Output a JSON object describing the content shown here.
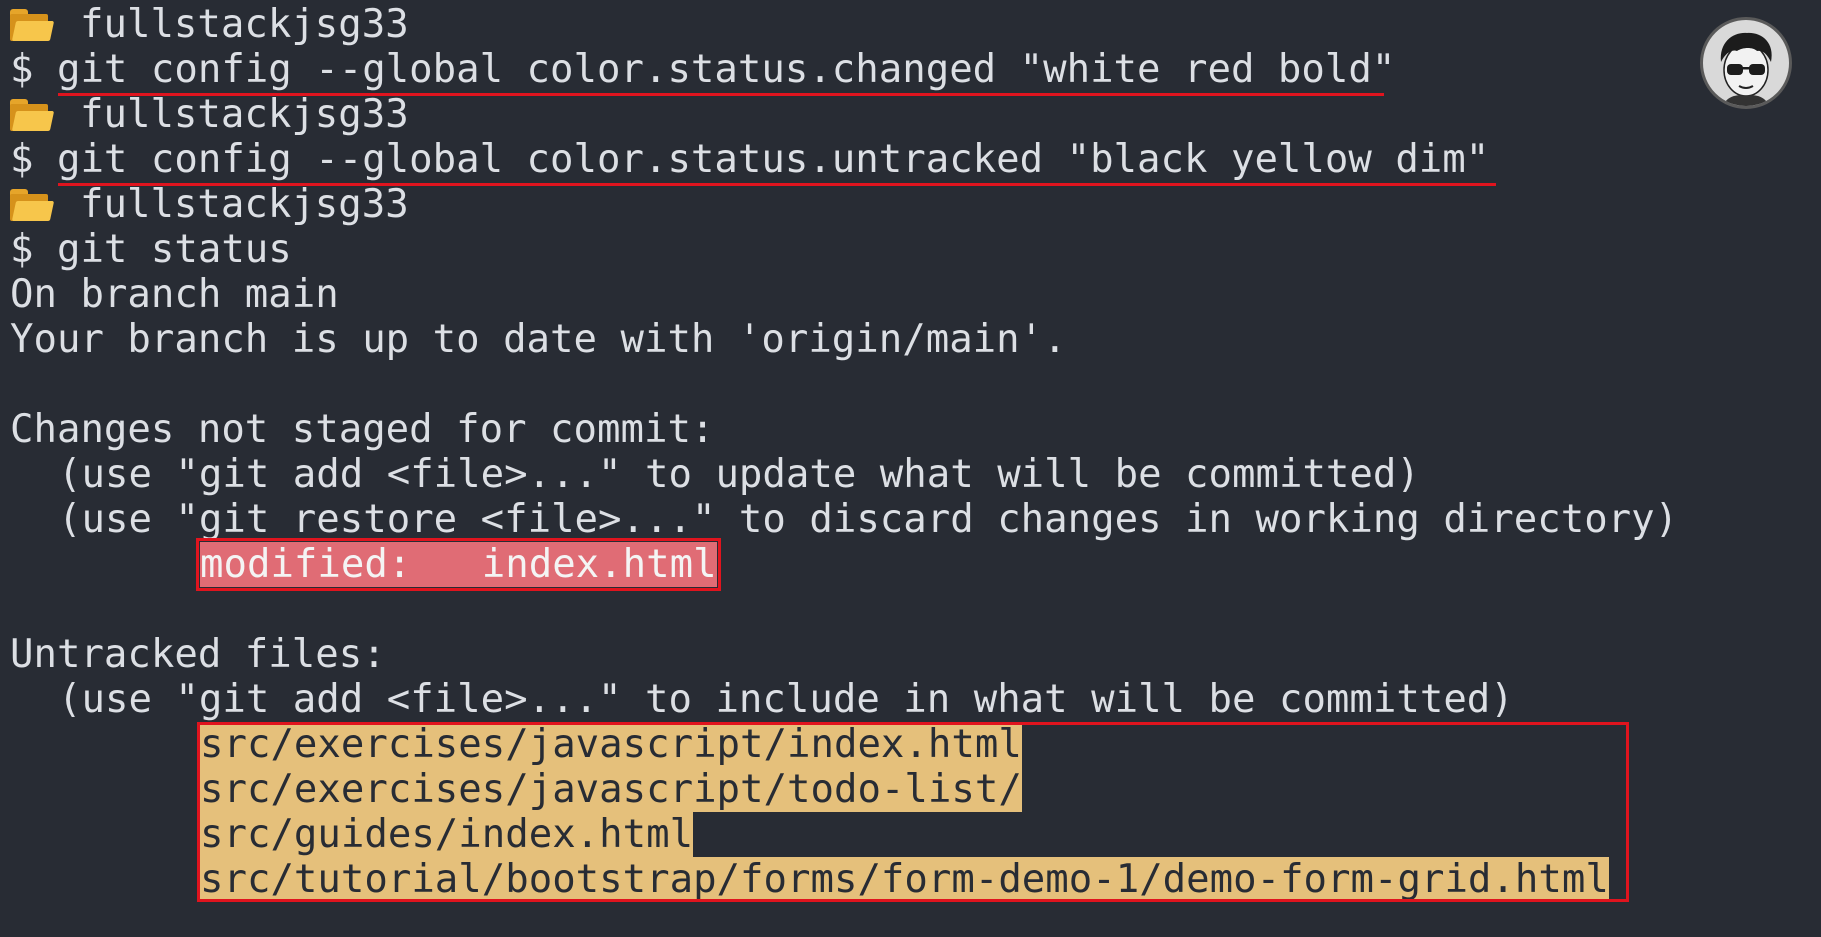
{
  "colors": {
    "background": "#282c34",
    "text": "#dcdfe4",
    "modified_bg": "#e06c75",
    "untracked_bg": "#e5c07b",
    "annotation_red": "#e0141e"
  },
  "icons": {
    "prompt_folder": "folder-icon",
    "user_avatar": "avatar-icon"
  },
  "prompts": [
    {
      "dir": "fullstackjsg33",
      "command": "$ git config --global color.status.changed \"white red bold\""
    },
    {
      "dir": "fullstackjsg33",
      "command": "$ git config --global color.status.untracked \"black yellow dim\""
    },
    {
      "dir": "fullstackjsg33",
      "command": "$ git status"
    }
  ],
  "status_output": {
    "branch_line": "On branch main",
    "upstream_line": "Your branch is up to date with 'origin/main'.",
    "unstaged_header": "Changes not staged for commit:",
    "unstaged_hint_1": "(use \"git add <file>...\" to update what will be committed)",
    "unstaged_hint_2": "(use \"git restore <file>...\" to discard changes in working directory)",
    "modified_entry": "modified:   index.html",
    "untracked_header": "Untracked files:",
    "untracked_hint": "(use \"git add <file>...\" to include in what will be committed)",
    "untracked_files": [
      "src/exercises/javascript/index.html",
      "src/exercises/javascript/todo-list/",
      "src/guides/index.html",
      "src/tutorial/bootstrap/forms/form-demo-1/demo-form-grid.html"
    ]
  }
}
